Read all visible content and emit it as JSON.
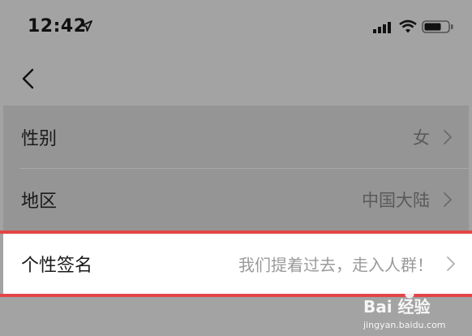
{
  "status_bar": {
    "time": "12:42"
  },
  "icons": {
    "location": "location-arrow-icon",
    "signal": "signal-bars-icon",
    "wifi": "wifi-icon",
    "battery": "battery-icon",
    "back": "back-chevron-icon"
  },
  "rows": {
    "gender": {
      "label": "性别",
      "value": "女"
    },
    "region": {
      "label": "地区",
      "value": "中国大陆"
    },
    "signature": {
      "label": "个性签名",
      "value": "我们提着过去，走入人群！"
    }
  },
  "watermark": {
    "logo": "Bai 经验",
    "sub": "jingyan.baidu.com"
  },
  "colors": {
    "highlight": "#e24646",
    "overlay": "#959595"
  }
}
